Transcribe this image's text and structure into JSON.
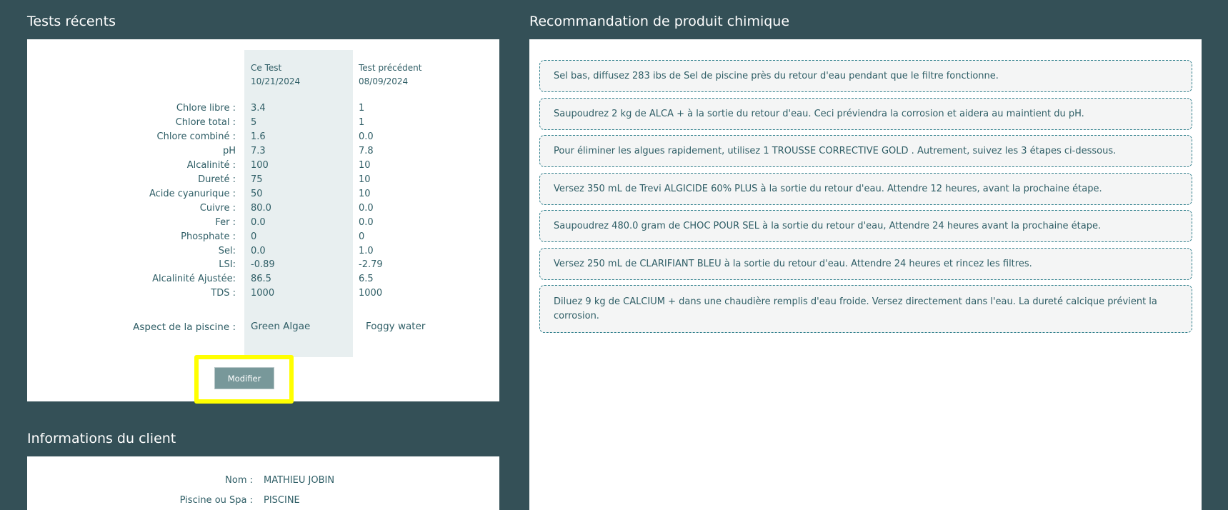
{
  "tests": {
    "title": "Tests récents",
    "current": {
      "label": "Ce Test",
      "date": "10/21/2024"
    },
    "previous": {
      "label": "Test précédent",
      "date": "08/09/2024"
    },
    "rows": [
      {
        "label": "Chlore libre :",
        "current": "3.4",
        "previous": "1"
      },
      {
        "label": "Chlore total :",
        "current": "5",
        "previous": "1"
      },
      {
        "label": "Chlore combiné :",
        "current": "1.6",
        "previous": "0.0"
      },
      {
        "label": "pH",
        "current": "7.3",
        "previous": "7.8"
      },
      {
        "label": "Alcalinité :",
        "current": "100",
        "previous": "10"
      },
      {
        "label": "Dureté :",
        "current": "75",
        "previous": "10"
      },
      {
        "label": "Acide cyanurique :",
        "current": "50",
        "previous": "10"
      },
      {
        "label": "Cuivre :",
        "current": "80.0",
        "previous": "0.0"
      },
      {
        "label": "Fer :",
        "current": "0.0",
        "previous": "0.0"
      },
      {
        "label": "Phosphate :",
        "current": "0",
        "previous": "0"
      },
      {
        "label": "Sel:",
        "current": "0.0",
        "previous": "1.0"
      },
      {
        "label": "LSI:",
        "current": "-0.89",
        "previous": "-2.79"
      },
      {
        "label": "Alcalinité Ajustée:",
        "current": "86.5",
        "previous": "6.5"
      },
      {
        "label": "TDS :",
        "current": "1000",
        "previous": "1000"
      }
    ],
    "aspect": {
      "label": "Aspect de la piscine :",
      "current": "Green Algae",
      "previous": "Foggy water"
    },
    "modify_label": "Modifier"
  },
  "client": {
    "title": "Informations du client",
    "fields": [
      {
        "label": "Nom :",
        "value": "MATHIEU JOBIN"
      },
      {
        "label": "Piscine ou Spa :",
        "value": "PISCINE"
      }
    ]
  },
  "recommendations": {
    "title": "Recommandation de produit chimique",
    "items": [
      "Sel bas, diffusez 283 ibs de Sel de piscine près du retour d'eau pendant que le filtre fonctionne.",
      "Saupoudrez 2 kg de ALCA + à la sortie du retour d'eau. Ceci préviendra la corrosion et aidera au maintient du pH.",
      "Pour éliminer les algues rapidement, utilisez 1 TROUSSE CORRECTIVE GOLD . Autrement, suivez les 3 étapes ci-dessous.",
      "Versez 350 mL de Trevi ALGICIDE 60% PLUS à la sortie du retour d'eau. Attendre 12 heures, avant la prochaine étape.",
      "Saupoudrez 480.0 gram de CHOC POUR SEL à la sortie du retour d'eau, Attendre 24 heures avant la prochaine étape.",
      "Versez 250 mL de CLARIFIANT BLEU à la sortie du retour d'eau. Attendre 24 heures et rincez les filtres.",
      "Diluez 9 kg de CALCIUM + dans une chaudière remplis d'eau froide. Versez directement dans l'eau. La dureté calcique prévient la corrosion."
    ]
  },
  "colors": {
    "background": "#345057",
    "text": "#2f5e66",
    "button": "#78989a",
    "highlight": "#ffff00"
  }
}
